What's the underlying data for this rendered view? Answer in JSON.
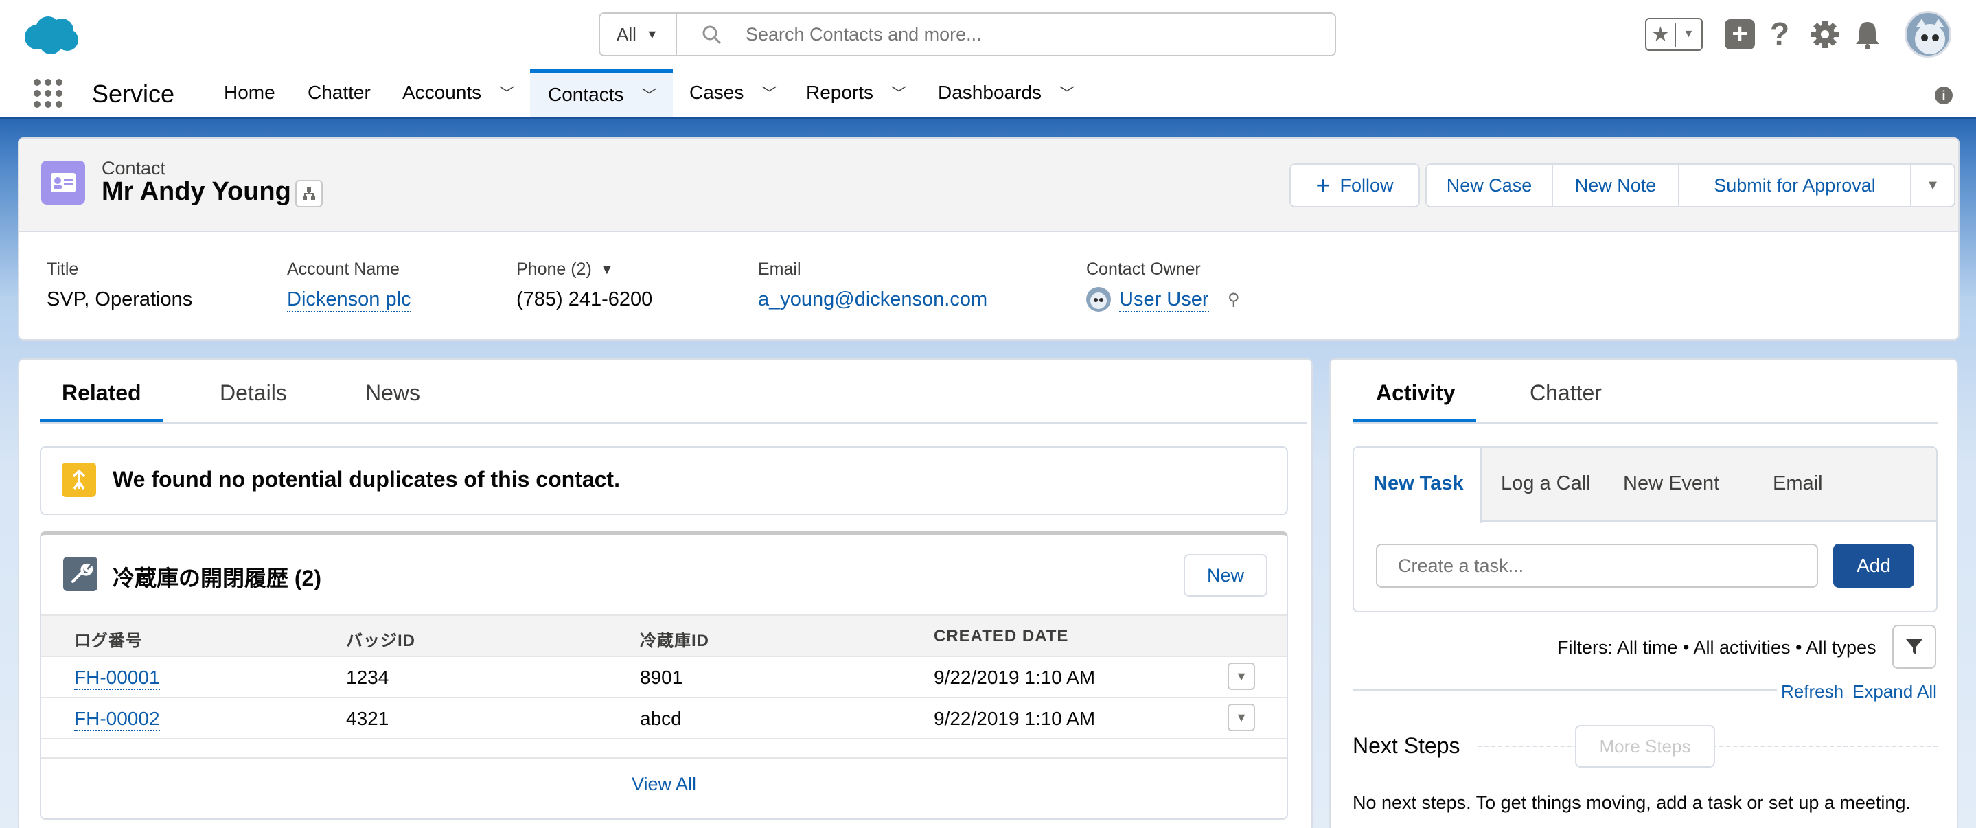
{
  "header": {
    "search_scope": "All",
    "search_placeholder": "Search Contacts and more..."
  },
  "nav": {
    "app_name": "Service",
    "items": [
      {
        "label": "Home"
      },
      {
        "label": "Chatter"
      },
      {
        "label": "Accounts"
      },
      {
        "label": "Contacts"
      },
      {
        "label": "Cases"
      },
      {
        "label": "Reports"
      },
      {
        "label": "Dashboards"
      }
    ]
  },
  "record": {
    "object_label": "Contact",
    "name": "Mr Andy Young",
    "actions": {
      "follow": "Follow",
      "new_case": "New Case",
      "new_note": "New Note",
      "submit": "Submit for Approval"
    },
    "fields": {
      "title_label": "Title",
      "title_value": "SVP, Operations",
      "account_label": "Account Name",
      "account_value": "Dickenson plc",
      "phone_label": "Phone (2)",
      "phone_value": "(785) 241-6200",
      "email_label": "Email",
      "email_value": "a_young@dickenson.com",
      "owner_label": "Contact Owner",
      "owner_value": "User User"
    }
  },
  "left": {
    "tabs": [
      {
        "label": "Related"
      },
      {
        "label": "Details"
      },
      {
        "label": "News"
      }
    ],
    "duplicates_message": "We found no potential duplicates of this contact.",
    "related_list": {
      "title": "冷蔵庫の開閉履歴 (2)",
      "new_button": "New",
      "columns": [
        "ログ番号",
        "バッジID",
        "冷蔵庫ID",
        "CREATED DATE"
      ],
      "rows": [
        {
          "log": "FH-00001",
          "badge": "1234",
          "fridge": "8901",
          "created": "9/22/2019 1:10 AM"
        },
        {
          "log": "FH-00002",
          "badge": "4321",
          "fridge": "abcd",
          "created": "9/22/2019 1:10 AM"
        }
      ],
      "view_all": "View All"
    }
  },
  "right": {
    "tabs": [
      {
        "label": "Activity"
      },
      {
        "label": "Chatter"
      }
    ],
    "sub_tabs": [
      {
        "label": "New Task"
      },
      {
        "label": "Log a Call"
      },
      {
        "label": "New Event"
      },
      {
        "label": "Email"
      }
    ],
    "task_placeholder": "Create a task...",
    "add_button": "Add",
    "filters": "Filters: All time • All activities • All types",
    "refresh": "Refresh",
    "expand_all": "Expand All",
    "next_steps_title": "Next Steps",
    "more_steps": "More Steps",
    "empty_message": "No next steps. To get things moving, add a task or set up a meeting."
  }
}
